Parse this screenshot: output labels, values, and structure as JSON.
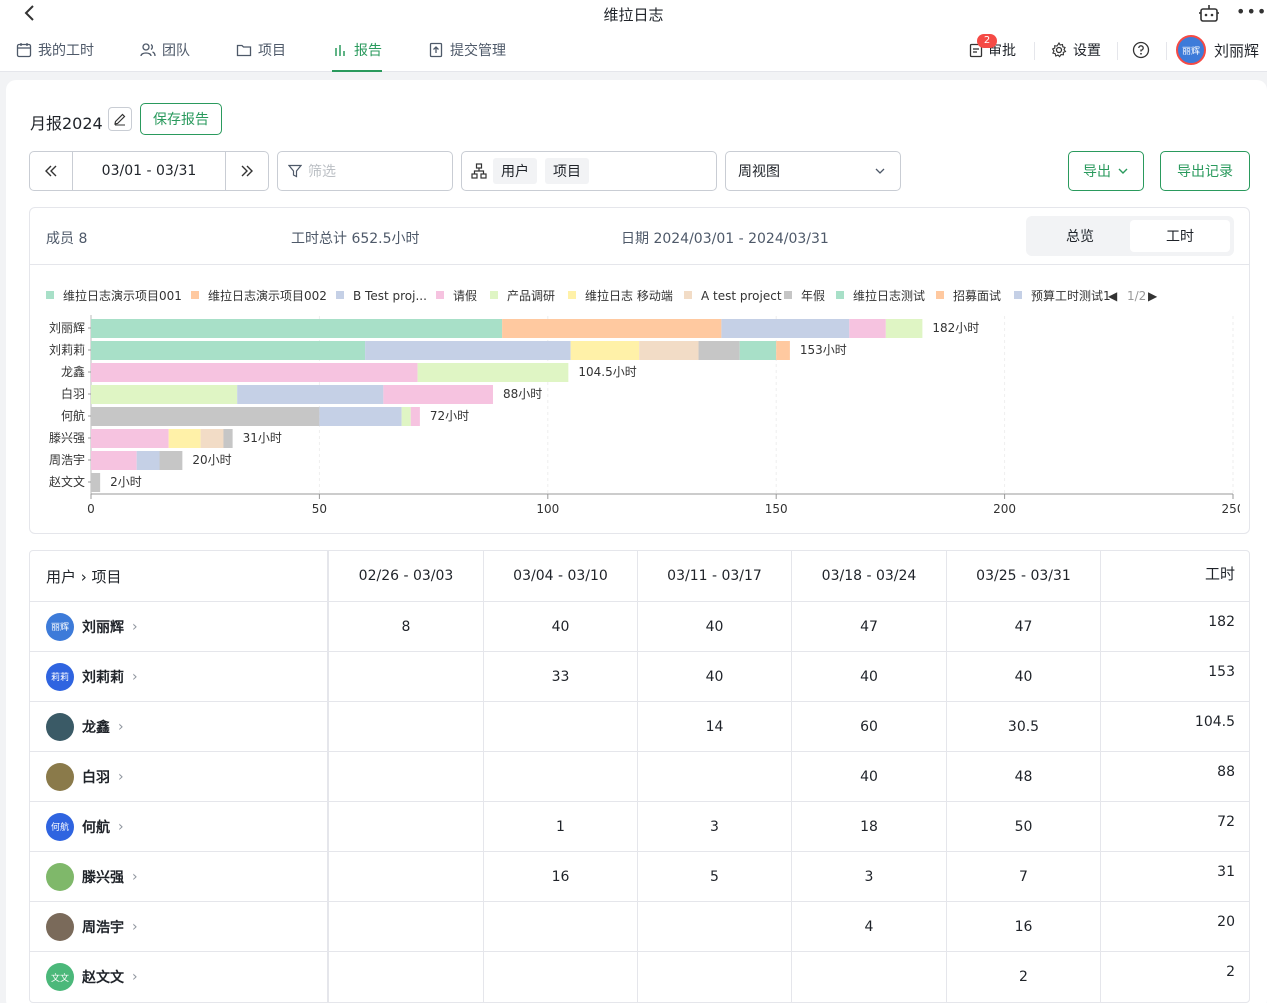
{
  "titlebar": {
    "title": "维拉日志"
  },
  "nav": {
    "tabs": [
      {
        "label": "我的工时",
        "icon": "calendar-icon",
        "active": false
      },
      {
        "label": "团队",
        "icon": "team-icon",
        "active": false
      },
      {
        "label": "项目",
        "icon": "folder-icon",
        "active": false
      },
      {
        "label": "报告",
        "icon": "chart-icon",
        "active": true
      },
      {
        "label": "提交管理",
        "icon": "submit-icon",
        "active": false
      }
    ],
    "approval": {
      "label": "审批",
      "badge": "2"
    },
    "settings": {
      "label": "设置"
    },
    "user": {
      "name": "刘丽辉",
      "avatar_text": "丽辉"
    }
  },
  "report": {
    "name": "月报2024",
    "save_label": "保存报告",
    "date_range": "03/01 - 03/31",
    "filter_placeholder": "筛选",
    "group_chips": [
      "用户",
      "项目"
    ],
    "view": "周视图",
    "export_label": "导出",
    "export_log_label": "导出记录"
  },
  "summary": {
    "members": "成员 8",
    "total": "工时总计 652.5小时",
    "date": "日期 2024/03/01 - 2024/03/31",
    "seg_overview": "总览",
    "seg_hours": "工时"
  },
  "chart_data": {
    "type": "bar",
    "orientation": "horizontal-stacked",
    "legend_page": "1/2",
    "legend": [
      {
        "name": "维拉日志演示项目001",
        "color": "#a8e0c8"
      },
      {
        "name": "维拉日志演示项目002",
        "color": "#ffc9a0"
      },
      {
        "name": "B Test proj...",
        "color": "#c5d0e6"
      },
      {
        "name": "请假",
        "color": "#f6c3e0"
      },
      {
        "name": "产品调研",
        "color": "#dff5c4"
      },
      {
        "name": "维拉日志 移动端",
        "color": "#fff1a8"
      },
      {
        "name": "A test project",
        "color": "#f2dcc6"
      },
      {
        "name": "年假",
        "color": "#c6c6c6"
      },
      {
        "name": "维拉日志测试",
        "color": "#a8e0c8"
      },
      {
        "name": "招募面试",
        "color": "#ffc9a0"
      },
      {
        "name": "预算工时测试1",
        "color": "#c5d0e6"
      }
    ],
    "categories": [
      "刘丽辉",
      "刘莉莉",
      "龙鑫",
      "白羽",
      "何航",
      "滕兴强",
      "周浩宇",
      "赵文文"
    ],
    "rows": [
      {
        "label": "182小时",
        "segments": [
          [
            90,
            "#a8e0c8"
          ],
          [
            48,
            "#ffc9a0"
          ],
          [
            28,
            "#c5d0e6"
          ],
          [
            8,
            "#f6c3e0"
          ],
          [
            8,
            "#dff5c4"
          ]
        ]
      },
      {
        "label": "153小时",
        "segments": [
          [
            60,
            "#a8e0c8"
          ],
          [
            45,
            "#c5d0e6"
          ],
          [
            15,
            "#fff1a8"
          ],
          [
            13,
            "#f2dcc6"
          ],
          [
            9,
            "#c6c6c6"
          ],
          [
            8,
            "#a8e0c8"
          ],
          [
            3,
            "#ffc9a0"
          ]
        ]
      },
      {
        "label": "104.5小时",
        "segments": [
          [
            71.5,
            "#f6c3e0"
          ],
          [
            33,
            "#dff5c4"
          ]
        ]
      },
      {
        "label": "88小时",
        "segments": [
          [
            32,
            "#dff5c4"
          ],
          [
            32,
            "#c5d0e6"
          ],
          [
            24,
            "#f6c3e0"
          ]
        ]
      },
      {
        "label": "72小时",
        "segments": [
          [
            50,
            "#c6c6c6"
          ],
          [
            18,
            "#c5d0e6"
          ],
          [
            2,
            "#dff5c4"
          ],
          [
            2,
            "#f6c3e0"
          ]
        ]
      },
      {
        "label": "31小时",
        "segments": [
          [
            17,
            "#f6c3e0"
          ],
          [
            7,
            "#fff1a8"
          ],
          [
            5,
            "#f2dcc6"
          ],
          [
            2,
            "#c6c6c6"
          ]
        ]
      },
      {
        "label": "20小时",
        "segments": [
          [
            10,
            "#f6c3e0"
          ],
          [
            5,
            "#c5d0e6"
          ],
          [
            5,
            "#c6c6c6"
          ]
        ]
      },
      {
        "label": "2小时",
        "segments": [
          [
            2,
            "#c6c6c6"
          ]
        ]
      }
    ],
    "xlim": [
      0,
      250
    ],
    "xticks": [
      0,
      50,
      100,
      150,
      200,
      250
    ]
  },
  "table": {
    "headers": [
      "用户 › 项目",
      "02/26 - 03/03",
      "03/04 - 03/10",
      "03/11 - 03/17",
      "03/18 - 03/24",
      "03/25 - 03/31",
      "工时"
    ],
    "rows": [
      {
        "name": "刘丽辉",
        "avatar": "丽辉",
        "color": "#3d7bd9",
        "cells": [
          "8",
          "40",
          "40",
          "47",
          "47"
        ],
        "total": "182"
      },
      {
        "name": "刘莉莉",
        "avatar": "莉莉",
        "color": "#2f64e0",
        "cells": [
          "",
          "33",
          "40",
          "40",
          "40"
        ],
        "total": "153"
      },
      {
        "name": "龙鑫",
        "avatar": "",
        "color": "#3a5a66",
        "cells": [
          "",
          "",
          "14",
          "60",
          "30.5"
        ],
        "total": "104.5"
      },
      {
        "name": "白羽",
        "avatar": "",
        "color": "#8a7a4a",
        "cells": [
          "",
          "",
          "",
          "40",
          "48"
        ],
        "total": "88"
      },
      {
        "name": "何航",
        "avatar": "何航",
        "color": "#2f64e0",
        "cells": [
          "",
          "1",
          "3",
          "18",
          "50"
        ],
        "total": "72"
      },
      {
        "name": "滕兴强",
        "avatar": "",
        "color": "#7fb86a",
        "cells": [
          "",
          "16",
          "5",
          "3",
          "7"
        ],
        "total": "31"
      },
      {
        "name": "周浩宇",
        "avatar": "",
        "color": "#7a6a5a",
        "cells": [
          "",
          "",
          "",
          "4",
          "16"
        ],
        "total": "20"
      },
      {
        "name": "赵文文",
        "avatar": "文文",
        "color": "#4bb87a",
        "cells": [
          "",
          "",
          "",
          "",
          "2"
        ],
        "total": "2"
      }
    ]
  }
}
